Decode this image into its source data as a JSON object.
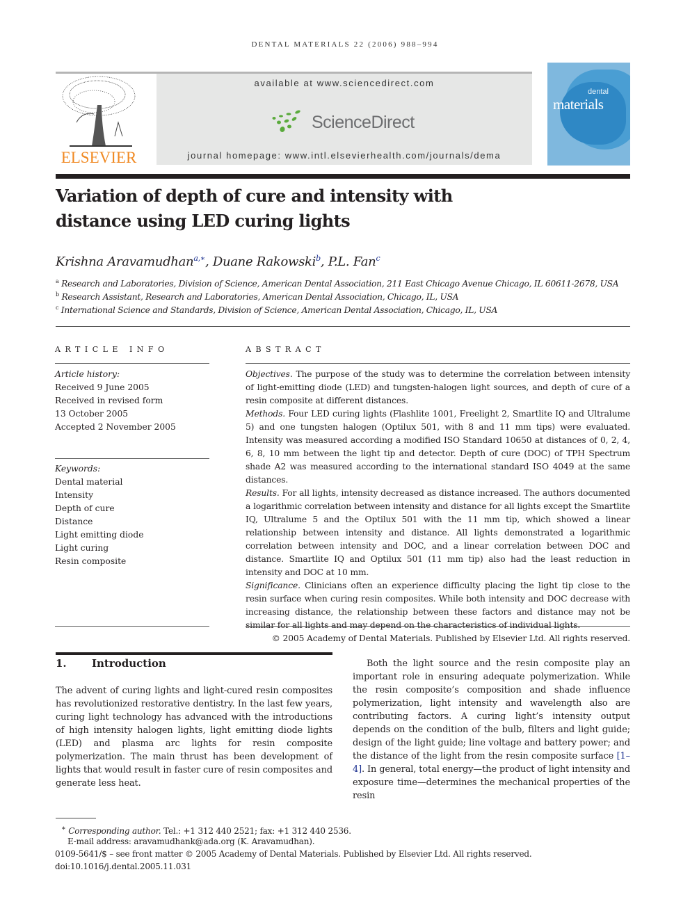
{
  "running_head": "dental materials 22 (2006) 988–994",
  "publisher": {
    "name": "ELSEVIER",
    "available_at": "available at www.sciencedirect.com",
    "sciencedirect_label": "ScienceDirect",
    "homepage": "journal homepage: www.intl.elsevierhealth.com/journals/dema",
    "colors": {
      "elsevier_orange": "#f08a24",
      "sciencedirect_green": "#5aaa3c",
      "band_gray": "#e6e7e6"
    }
  },
  "cover": {
    "line1": "dental",
    "line2": "materials",
    "color": "#7fb8de"
  },
  "article": {
    "title_line1": "Variation of depth of cure and intensity with",
    "title_line2": "distance using LED curing lights",
    "authors": [
      {
        "name": "Krishna Aravamudhan",
        "sup": "a,∗",
        "sep": ", "
      },
      {
        "name": "Duane Rakowski",
        "sup": "b",
        "sep": ", "
      },
      {
        "name": "P.L. Fan",
        "sup": "c",
        "sep": ""
      }
    ],
    "affiliations": [
      {
        "key": "a",
        "text": "Research and Laboratories, Division of Science, American Dental Association, 211 East Chicago Avenue Chicago, IL 60611-2678, USA"
      },
      {
        "key": "b",
        "text": "Research Assistant, Research and Laboratories, American Dental Association, Chicago, IL, USA"
      },
      {
        "key": "c",
        "text": "International Science and Standards, Division of Science, American Dental Association, Chicago, IL, USA"
      }
    ]
  },
  "article_info": {
    "heading": "ARTICLE INFO",
    "history_label": "Article history:",
    "history": [
      "Received 9 June 2005",
      "Received in revised form",
      "13 October 2005",
      "Accepted 2 November 2005"
    ],
    "keywords_label": "Keywords:",
    "keywords": [
      "Dental material",
      "Intensity",
      "Depth of cure",
      "Distance",
      "Light emitting diode",
      "Light curing",
      "Resin composite"
    ]
  },
  "abstract": {
    "heading": "ABSTRACT",
    "sections": [
      {
        "label": "Objectives.",
        "text": " The purpose of the study was to determine the correlation between intensity of light-emitting diode (LED) and tungsten-halogen light sources, and depth of cure of a resin composite at different distances."
      },
      {
        "label": "Methods.",
        "text": " Four LED curing lights (Flashlite 1001, Freelight 2, Smartlite IQ and Ultralume 5) and one tungsten halogen (Optilux 501, with 8 and 11 mm tips) were evaluated. Intensity was measured according a modified ISO Standard 10650 at distances of 0, 2, 4, 6, 8, 10 mm between the light tip and detector. Depth of cure (DOC) of TPH Spectrum shade A2 was measured according to the international standard ISO 4049 at the same distances."
      },
      {
        "label": "Results.",
        "text": " For all lights, intensity decreased as distance increased. The authors documented a logarithmic correlation between intensity and distance for all lights except the Smartlite IQ, Ultralume 5 and the Optilux 501 with the 11 mm tip, which showed a linear relationship between intensity and distance. All lights demonstrated a logarithmic correlation between intensity and DOC, and a linear correlation between DOC and distance. Smartlite IQ and Optilux 501 (11 mm tip) also had the least reduction in intensity and DOC at 10 mm."
      },
      {
        "label": "Significance.",
        "text": " Clinicians often an experience difficulty placing the light tip close to the resin surface when curing resin composites. While both intensity and DOC decrease with increasing distance, the relationship between these factors and distance may not be similar for all lights and may depend on the characteristics of individual lights."
      }
    ],
    "copyright": "© 2005 Academy of Dental Materials. Published by Elsevier Ltd. All rights reserved."
  },
  "introduction": {
    "number": "1.",
    "heading": "Introduction",
    "para1": "The advent of curing lights and light-cured resin composites has revolutionized restorative dentistry. In the last few years, curing light technology has advanced with the introductions of high intensity halogen lights, light emitting diode lights (LED) and plasma arc lights for resin composite polymerization. The main thrust has been development of lights that would result in faster cure of resin composites and generate less heat.",
    "para2_a": "Both the light source and the resin composite play an important role in ensuring adequate polymerization. While the resin composite’s composition and shade influence polymerization, light intensity and wavelength also are contributing factors. A curing light’s intensity output depends on the condition of the bulb, filters and light guide; design of the light guide; line voltage and battery power; and the distance of the light from the resin composite surface ",
    "para2_cite": "[1–4]",
    "para2_b": ". In general, total energy—the product of light intensity and exposure time—determines the mechanical properties of the resin"
  },
  "footnotes": {
    "corresponding_mark": "∗",
    "corresponding_label": "Corresponding author.",
    "corresponding_text": " Tel.: +1 312 440 2521; fax: +1 312 440 2536.",
    "email": "E-mail address: aravamudhank@ada.org (K. Aravamudhan).",
    "front_matter": "0109-5641/$ – see front matter © 2005 Academy of Dental Materials. Published by Elsevier Ltd. All rights reserved.",
    "doi": "doi:10.1016/j.dental.2005.11.031"
  }
}
